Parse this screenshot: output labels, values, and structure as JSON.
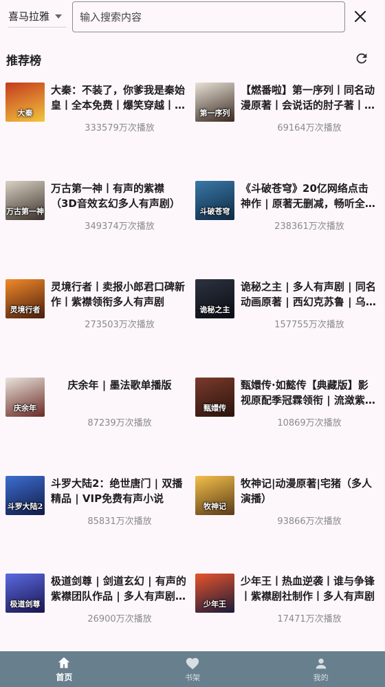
{
  "header": {
    "source_select": "喜马拉雅",
    "search_placeholder": "输入搜索内容"
  },
  "section": {
    "title": "推荐榜"
  },
  "items": [
    {
      "title": "大秦：不装了，你爹我是秦始皇丨全本免费丨爆笑穿越丨…",
      "plays": "333579万次播放",
      "cover_text": "大秦",
      "cover_colors": [
        "#c43a1e",
        "#f2c53d"
      ]
    },
    {
      "title": "【燃番啦】第一序列丨同名动漫原著丨会说话的肘子著丨…",
      "plays": "69164万次播放",
      "cover_text": "第一序列",
      "cover_colors": [
        "#e8e2d6",
        "#3a2a22"
      ]
    },
    {
      "title": "万古第一神丨有声的紫襟（3D音效玄幻多人有声剧）",
      "plays": "349374万次播放",
      "cover_text": "万古第一神",
      "cover_colors": [
        "#d9d2c4",
        "#3b302a"
      ]
    },
    {
      "title": "《斗破苍穹》20亿网络点击神作 | 原著无删减，畅听全…",
      "plays": "238361万次播放",
      "cover_text": "斗破苍穹",
      "cover_colors": [
        "#3a78a8",
        "#0e2942"
      ]
    },
    {
      "title": "灵境行者丨卖报小郎君口碑新作丨紫襟领衔多人有声剧",
      "plays": "273503万次播放",
      "cover_text": "灵境行者",
      "cover_colors": [
        "#f08a2a",
        "#4a1d0c"
      ]
    },
    {
      "title": "诡秘之主 | 多人有声剧 | 同名动画原著 | 西幻克苏鲁 | 乌…",
      "plays": "157755万次播放",
      "cover_text": "诡秘之主",
      "cover_colors": [
        "#2c3340",
        "#0a0c12"
      ]
    },
    {
      "title": "庆余年 | 墨法歌单播版",
      "plays": "87239万次播放",
      "cover_text": "庆余年",
      "cover_colors": [
        "#e8e4dc",
        "#6a2a24"
      ]
    },
    {
      "title": "甄嬛传·如懿传【典藏版】影视原配季冠霖领衔 | 流潋紫…",
      "plays": "10869万次播放",
      "cover_text": "甄嬛传",
      "cover_colors": [
        "#7a3a2c",
        "#2a130c"
      ]
    },
    {
      "title": "斗罗大陆2：绝世唐门 | 双播精品 | VIP免费有声小说",
      "plays": "85831万次播放",
      "cover_text": "斗罗大陆2",
      "cover_colors": [
        "#3c6ed0",
        "#121a46"
      ]
    },
    {
      "title": "牧神记|动漫原著|宅猪（多人演播）",
      "plays": "93866万次播放",
      "cover_text": "牧神记",
      "cover_colors": [
        "#f3c04a",
        "#5a3a18"
      ]
    },
    {
      "title": "极道剑尊 | 剑道玄幻 | 有声的紫襟团队作品 | 多人有声剧 |…",
      "plays": "26900万次播放",
      "cover_text": "极道剑尊",
      "cover_colors": [
        "#5a6ae0",
        "#1a1450"
      ]
    },
    {
      "title": "少年王丨热血逆袭丨谁与争锋丨紫襟剧社制作丨多人有声剧",
      "plays": "17471万次播放",
      "cover_text": "少年王",
      "cover_colors": [
        "#e8542a",
        "#1a1a3a"
      ]
    }
  ],
  "nav": [
    {
      "label": "首页",
      "icon": "home-icon",
      "active": true
    },
    {
      "label": "书架",
      "icon": "heart-icon",
      "active": false
    },
    {
      "label": "我的",
      "icon": "person-icon",
      "active": false
    }
  ],
  "colors": {
    "background": "#fdf7fb",
    "nav_bar": "#687f8e",
    "text_primary": "#1d1b1e",
    "text_secondary": "#8a8a8a"
  }
}
